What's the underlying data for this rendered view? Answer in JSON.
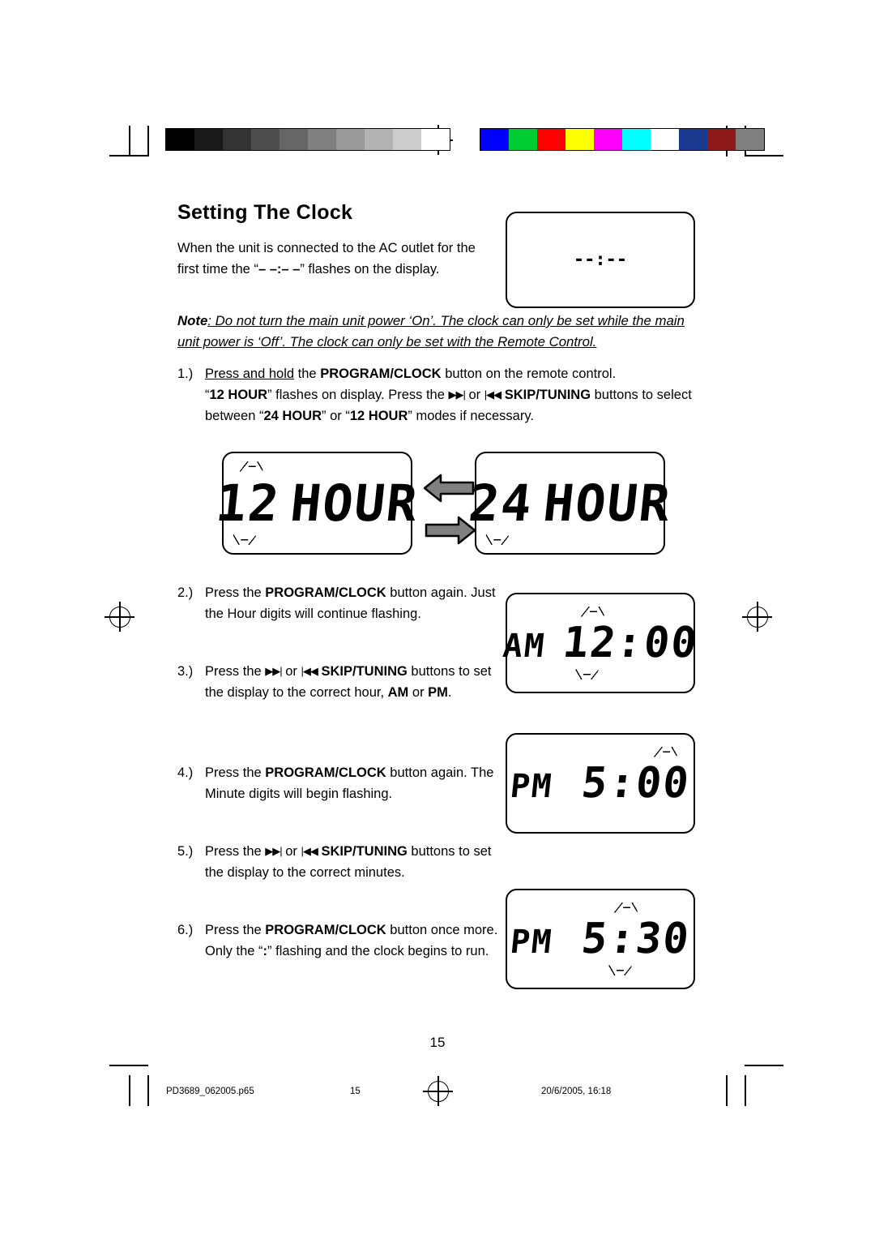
{
  "document": {
    "title": "Setting The Clock",
    "page_number": "15",
    "intro": "When the unit is connected to the AC outlet for the first time the “– –:– –” flashes on the display.",
    "note_label": "Note",
    "note_text": ": Do not turn the main unit power ‘On’. The clock can only be set while the main unit power is ‘Off’. The clock can only be set with the Remote Control.",
    "steps": [
      {
        "num": "1.)",
        "line1_pre": "Press and hold",
        "line1_mid": " the ",
        "line1_bold": "PROGRAM/CLOCK",
        "line1_post": " button on the remote control.",
        "line2": "“12 HOUR” flashes on display. Press the ▶▶| or |◀◀ SKIP/TUNING buttons to select between “24 HOUR” or “12 HOUR” modes if necessary."
      },
      {
        "num": "2.)",
        "text": "Press the PROGRAM/CLOCK button again. Just the Hour digits will continue flashing."
      },
      {
        "num": "3.)",
        "text": "Press the ▶▶| or |◀◀ SKIP/TUNING buttons to set the display to the correct hour, AM or PM."
      },
      {
        "num": "4.)",
        "text": "Press the PROGRAM/CLOCK button again. The Minute digits will begin flashing."
      },
      {
        "num": "5.)",
        "text": "Press the ▶▶| or |◀◀ SKIP/TUNING buttons to set the display to the correct minutes."
      },
      {
        "num": "6.)",
        "text": "Press the PROGRAM/CLOCK button once more. Only the “:” flashing and the clock begins to run."
      }
    ]
  },
  "displays": {
    "dashes": "--:--",
    "twelve_hour": "12 HOUR",
    "twelve_hour_digits": "12",
    "twelve_hour_word": "HOUR",
    "twentyfour_hour_digits": "24",
    "twentyfour_hour_word": "HOUR",
    "am_1200": {
      "meridiem": "AM",
      "hour": "12",
      "sep": ":",
      "minute": "00"
    },
    "pm_500": {
      "meridiem": "PM",
      "hour": "5",
      "sep": ":",
      "minute": "00"
    },
    "pm_530": {
      "meridiem": "PM",
      "hour": "5",
      "sep": ":",
      "minute": "30"
    }
  },
  "footer": {
    "file_name": "PD3689_062005.p65",
    "page": "15",
    "timestamp": "20/6/2005, 16:18"
  },
  "colors": {
    "grayscale": [
      "#000000",
      "#1a1a1a",
      "#333333",
      "#4d4d4d",
      "#666666",
      "#808080",
      "#999999",
      "#b3b3b3",
      "#cccccc",
      "#ffffff"
    ],
    "chromatic": [
      "#0000ff",
      "#00cc33",
      "#ff0000",
      "#ffff00",
      "#ff00ff",
      "#00ffff",
      "#ffffff",
      "#1a3a8f",
      "#8f1a1a",
      "#808080"
    ]
  }
}
